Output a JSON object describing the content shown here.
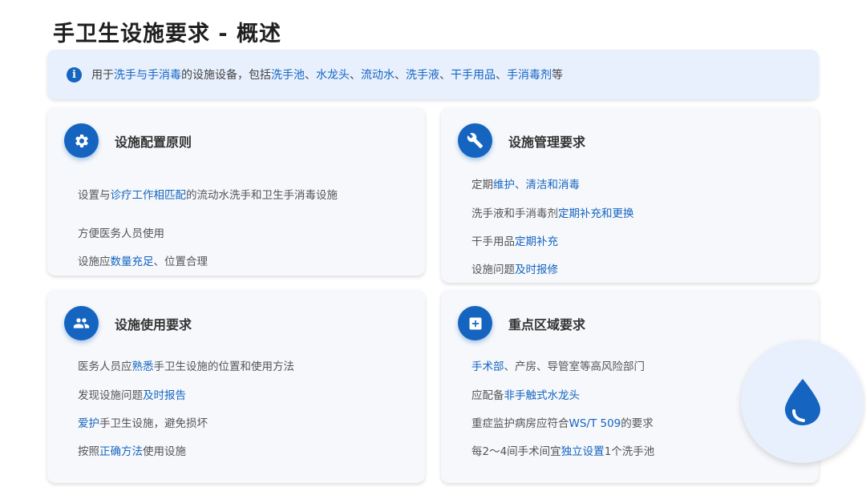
{
  "title": "手卫生设施要求 - 概述",
  "colors": {
    "accent": "#1565c0",
    "banner_bg": "#e8f0fe",
    "card_bg": "#f6f8fb"
  },
  "banner": {
    "icon": "info-icon",
    "text": [
      "用于",
      "洗手与手消毒",
      "的设施设备，包括",
      "洗手池",
      "、",
      "水龙头",
      "、",
      "流动水",
      "、",
      "洗手液",
      "、",
      "干手用品",
      "、",
      "手消毒剂",
      "等"
    ]
  },
  "cards": [
    {
      "icon": "gear-icon",
      "title": "设施配置原则",
      "items": [
        [
          "设置与",
          "诊疗工作相匹配",
          "的流动水洗手和卫生手消毒设施"
        ],
        [
          "方便医务人员使用"
        ],
        [
          "设施应",
          "数量充足",
          "、位置合理"
        ]
      ]
    },
    {
      "icon": "wrench-icon",
      "title": "设施管理要求",
      "items": [
        [
          "定期",
          "维护、清洁和消毒"
        ],
        [
          "洗手液和手消毒剂",
          "定期补充和更换"
        ],
        [
          "干手用品",
          "定期补充"
        ],
        [
          "设施问题",
          "及时报修"
        ]
      ]
    },
    {
      "icon": "people-icon",
      "title": "设施使用要求",
      "items": [
        [
          "医务人员应",
          "熟悉",
          "手卫生设施的位置和使用方法"
        ],
        [
          "发现设施问题",
          "及时报告"
        ],
        [
          "",
          "爱护",
          "手卫生设施，避免损坏"
        ],
        [
          "按照",
          "正确方法",
          "使用设施"
        ]
      ]
    },
    {
      "icon": "medical-plus-icon",
      "title": "重点区域要求",
      "items": [
        [
          "",
          "手术部",
          "、产房、导管室等高风险部门"
        ],
        [
          "应配备",
          "非手触式水龙头"
        ],
        [
          "重症监护病房应符合",
          "WS/T 509",
          "的要求"
        ],
        [
          "每2～4间手术间宜",
          "独立设置",
          "1个洗手池"
        ]
      ]
    }
  ],
  "decoration": {
    "icon": "water-drop-icon"
  }
}
